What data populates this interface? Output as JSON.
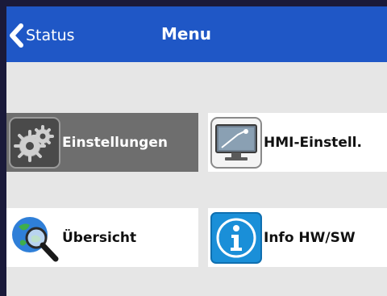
{
  "header": {
    "back_label": "Status",
    "title": "Menu"
  },
  "tiles": [
    {
      "label": "Einstellungen",
      "icon": "gear-icon",
      "state": "selected"
    },
    {
      "label": "HMI-Einstell.",
      "icon": "monitor-icon",
      "state": "normal"
    },
    {
      "label": "Übersicht",
      "icon": "globe-search-icon",
      "state": "normal"
    },
    {
      "label": "Info HW/SW",
      "icon": "info-icon",
      "state": "normal"
    }
  ],
  "colors": {
    "header_bg": "#1f57c6",
    "body_bg": "#e6e6e6",
    "selected_tile": "#6e6e6e",
    "info_blue": "#1a8fd8"
  }
}
